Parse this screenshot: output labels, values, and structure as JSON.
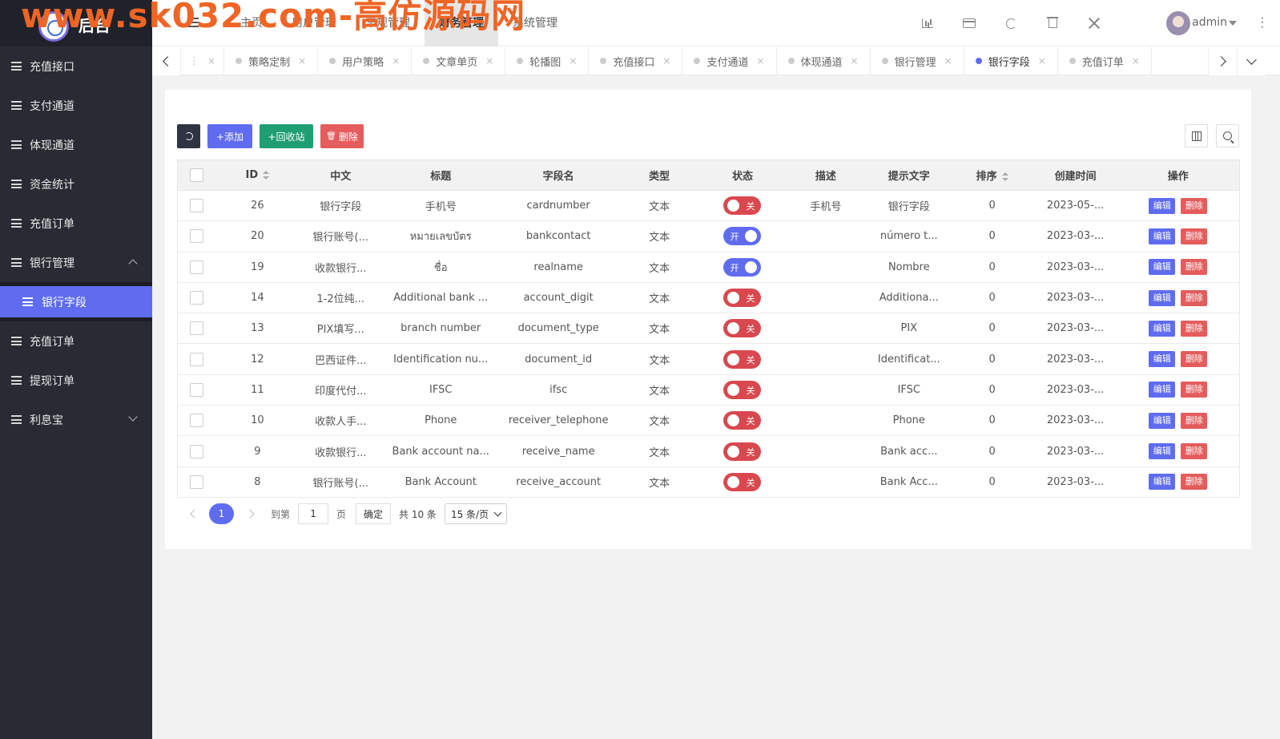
{
  "watermark": "www.sk032.com-高仿源码网",
  "logo": {
    "text": "后台"
  },
  "sidebar": {
    "items": [
      {
        "label": "充值接口"
      },
      {
        "label": "支付通道"
      },
      {
        "label": "体现通道"
      },
      {
        "label": "资金统计"
      },
      {
        "label": "充值订单"
      },
      {
        "label": "银行管理"
      },
      {
        "label": "充值订单"
      },
      {
        "label": "提现订单"
      },
      {
        "label": "利息宝"
      }
    ],
    "active_sub": {
      "label": "银行字段"
    }
  },
  "header": {
    "top_menu": [
      "主页",
      "用户管理",
      "常规管理",
      "财务管理",
      "系统管理"
    ],
    "active_menu": "财务管理",
    "icons": [
      "chart-icon",
      "card-icon",
      "refresh-icon",
      "trash-icon",
      "fullscreen-icon"
    ],
    "user": "admin",
    "more": "⋮"
  },
  "tabs": [
    {
      "label": "策略定制",
      "close": "×"
    },
    {
      "label": "用户策略",
      "close": "×"
    },
    {
      "label": "文章单页",
      "close": "×"
    },
    {
      "label": "轮播图",
      "close": "×"
    },
    {
      "label": "充值接口",
      "close": "×"
    },
    {
      "label": "支付通道",
      "close": "×"
    },
    {
      "label": "体现通道",
      "close": "×"
    },
    {
      "label": "银行管理",
      "close": "×"
    },
    {
      "label": "银行字段",
      "close": "×",
      "active": true
    },
    {
      "label": "充值订单",
      "close": "×"
    }
  ],
  "toolbar": {
    "add": "+添加",
    "recycle": "+回收站",
    "delete": "删除"
  },
  "table": {
    "headers": [
      "ID",
      "中文",
      "标题",
      "字段名",
      "类型",
      "状态",
      "描述",
      "提示文字",
      "排序",
      "创建时间",
      "操作"
    ],
    "status_on": "开",
    "status_off": "关",
    "edit_label": "编辑",
    "del_label": "删除",
    "rows": [
      {
        "id": "26",
        "cn": "银行字段",
        "title": "手机号",
        "field": "cardnumber",
        "type": "文本",
        "status": "off",
        "desc": "手机号",
        "tip": "银行字段",
        "sort": "0",
        "created": "2023-05-..."
      },
      {
        "id": "20",
        "cn": "银行账号(...",
        "title": "หมายเลขบัตร",
        "field": "bankcontact",
        "type": "文本",
        "status": "on",
        "desc": "",
        "tip": "número t...",
        "sort": "0",
        "created": "2023-03-..."
      },
      {
        "id": "19",
        "cn": "收款银行...",
        "title": "ชื่อ",
        "field": "realname",
        "type": "文本",
        "status": "on",
        "desc": "",
        "tip": "Nombre",
        "sort": "0",
        "created": "2023-03-..."
      },
      {
        "id": "14",
        "cn": "1-2位纯...",
        "title": "Additional bank ...",
        "field": "account_digit",
        "type": "文本",
        "status": "off",
        "desc": "",
        "tip": "Additiona...",
        "sort": "0",
        "created": "2023-03-..."
      },
      {
        "id": "13",
        "cn": "PIX填写...",
        "title": "branch number",
        "field": "document_type",
        "type": "文本",
        "status": "off",
        "desc": "",
        "tip": "PIX",
        "sort": "0",
        "created": "2023-03-..."
      },
      {
        "id": "12",
        "cn": "巴西证件...",
        "title": "Identification nu...",
        "field": "document_id",
        "type": "文本",
        "status": "off",
        "desc": "",
        "tip": "Identificat...",
        "sort": "0",
        "created": "2023-03-..."
      },
      {
        "id": "11",
        "cn": "印度代付...",
        "title": "IFSC",
        "field": "ifsc",
        "type": "文本",
        "status": "off",
        "desc": "",
        "tip": "IFSC",
        "sort": "0",
        "created": "2023-03-..."
      },
      {
        "id": "10",
        "cn": "收款人手...",
        "title": "Phone",
        "field": "receiver_telephone",
        "type": "文本",
        "status": "off",
        "desc": "",
        "tip": "Phone",
        "sort": "0",
        "created": "2023-03-..."
      },
      {
        "id": "9",
        "cn": "收款银行...",
        "title": "Bank account na...",
        "field": "receive_name",
        "type": "文本",
        "status": "off",
        "desc": "",
        "tip": "Bank acc...",
        "sort": "0",
        "created": "2023-03-..."
      },
      {
        "id": "8",
        "cn": "银行账号(...",
        "title": "Bank Account",
        "field": "receive_account",
        "type": "文本",
        "status": "off",
        "desc": "",
        "tip": "Bank Acc...",
        "sort": "0",
        "created": "2023-03-..."
      }
    ]
  },
  "pager": {
    "current": "1",
    "goto_label": "到第",
    "goto_value": "1",
    "page_label": "页",
    "ok_label": "确定",
    "total": "共 10 条",
    "per_page": "15 条/页"
  },
  "colors": {
    "accent": "#5f6cf0",
    "danger": "#e45c5c",
    "success": "#1e9e72",
    "sidebar": "#282b33"
  }
}
